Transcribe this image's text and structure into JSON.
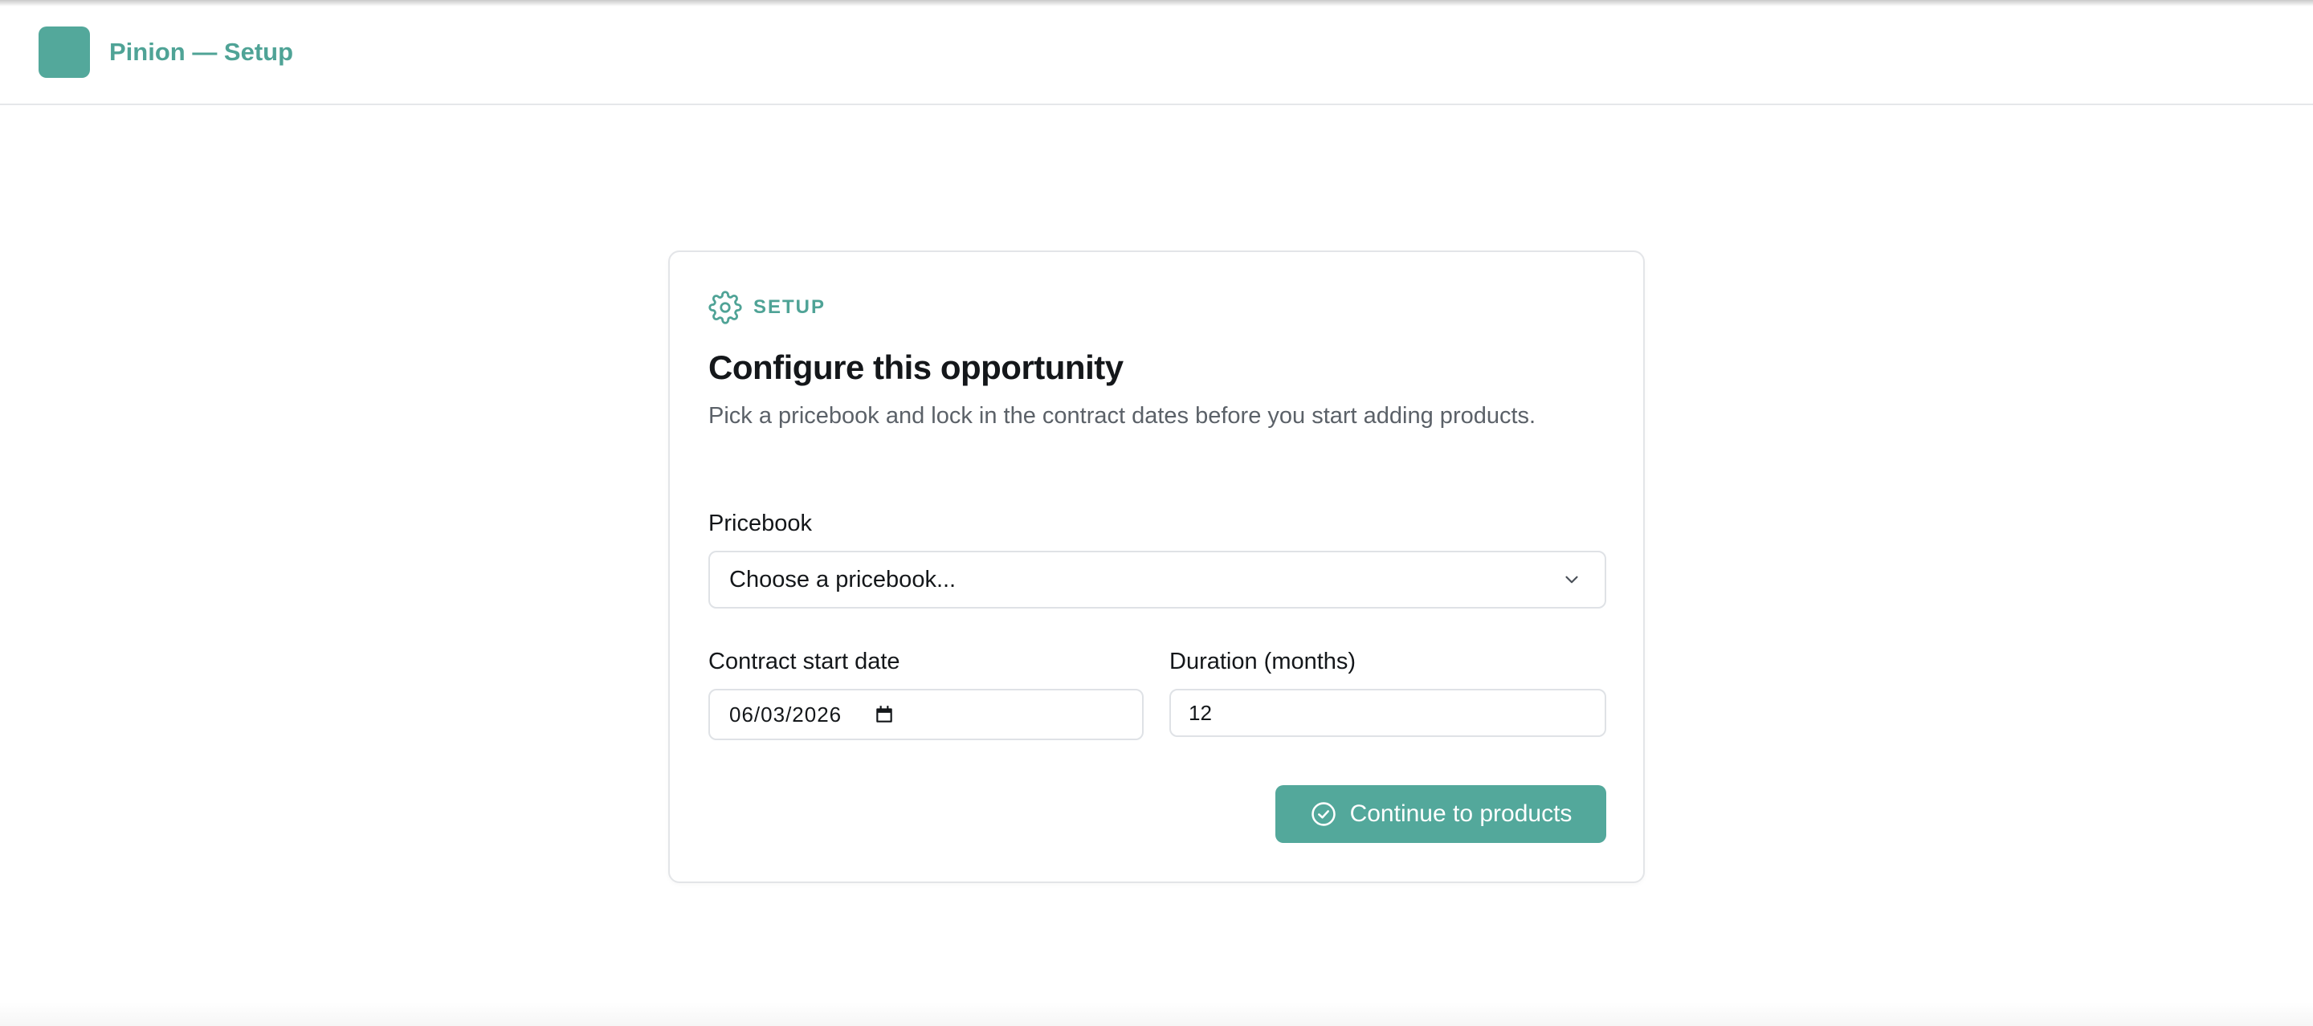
{
  "app": {
    "title": "Pinion — Setup"
  },
  "card": {
    "eyebrow": "SETUP",
    "title": "Configure this opportunity",
    "description": "Pick a pricebook and lock in the contract dates before you start adding products."
  },
  "form": {
    "pricebook_label": "Pricebook",
    "pricebook_value": "Choose a pricebook...",
    "start_date_label": "Contract start date",
    "start_date_value": "06/03/2026",
    "duration_label": "Duration (months)",
    "duration_value": "12"
  },
  "actions": {
    "continue_label": "Continue to products"
  },
  "colors": {
    "accent": "#53a89b",
    "text": "#14171a",
    "muted": "#5b6168",
    "border": "#dfe2e6"
  },
  "icons": {
    "logo": "logo-icon",
    "eyebrow": "gear-icon",
    "select": "chevron-down-icon",
    "date": "calendar-icon",
    "button": "check-circle-icon"
  }
}
